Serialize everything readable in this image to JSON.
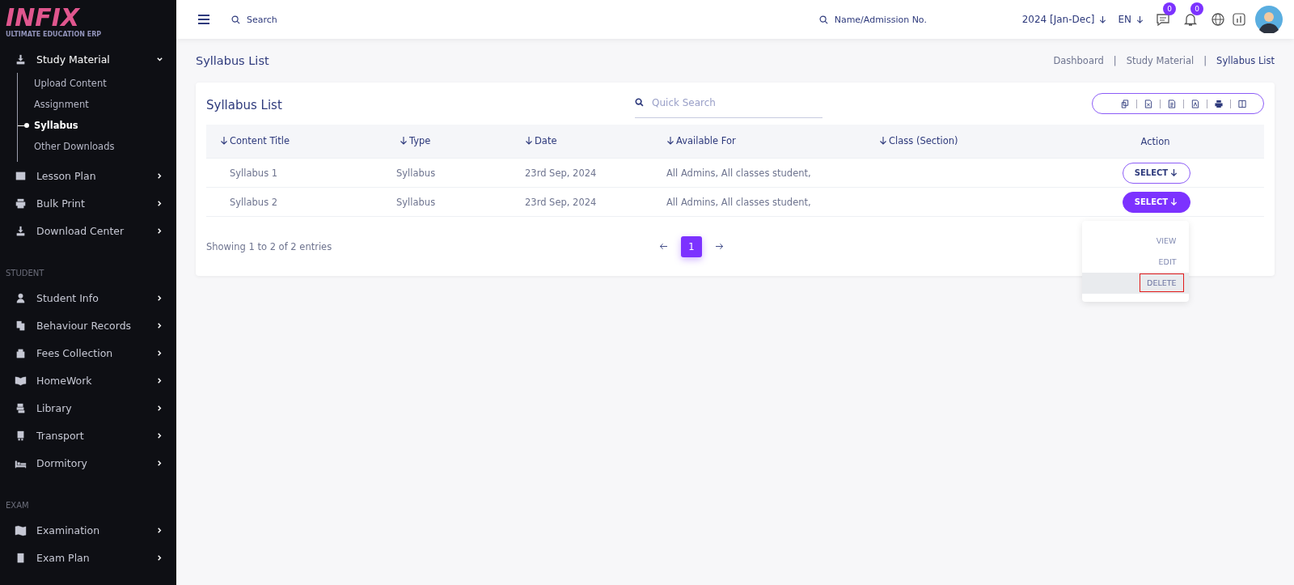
{
  "sidebar": {
    "logo": "INFIX",
    "tagline": "ULTIMATE EDUCATION ERP",
    "sections": [
      {
        "items": [
          {
            "label": "Study Material",
            "expanded": true,
            "children": [
              {
                "label": "Upload Content",
                "selected": false
              },
              {
                "label": "Assignment",
                "selected": false
              },
              {
                "label": "Syllabus",
                "selected": true
              },
              {
                "label": "Other Downloads",
                "selected": false
              }
            ]
          },
          {
            "label": "Lesson Plan",
            "expanded": false
          },
          {
            "label": "Bulk Print",
            "expanded": false
          },
          {
            "label": "Download Center",
            "expanded": false
          }
        ]
      },
      {
        "heading": "STUDENT",
        "items": [
          {
            "label": "Student Info",
            "expanded": false
          },
          {
            "label": "Behaviour Records",
            "expanded": false
          },
          {
            "label": "Fees Collection",
            "expanded": false
          },
          {
            "label": "HomeWork",
            "expanded": false
          },
          {
            "label": "Library",
            "expanded": false
          },
          {
            "label": "Transport",
            "expanded": false
          },
          {
            "label": "Dormitory",
            "expanded": false
          }
        ]
      },
      {
        "heading": "EXAM",
        "items": [
          {
            "label": "Examination",
            "expanded": false
          },
          {
            "label": "Exam Plan",
            "expanded": false
          }
        ]
      }
    ]
  },
  "header": {
    "search": {
      "placeholder": "Search"
    },
    "student_search": {
      "placeholder": "Name/Admission No."
    },
    "session": "2024 [Jan-Dec]",
    "language": "EN",
    "messages_count": "0",
    "notifications_count": "0"
  },
  "page": {
    "title": "Syllabus List",
    "breadcrumb_separator": "|",
    "breadcrumb": [
      {
        "label": "Dashboard",
        "selected": false
      },
      {
        "label": "Study Material",
        "selected": false
      },
      {
        "label": "Syllabus List",
        "selected": true
      }
    ]
  },
  "card": {
    "title": "Syllabus List",
    "quick_search": {
      "placeholder": "Quick Search"
    },
    "table": {
      "columns": [
        {
          "label": "Content Title",
          "sortable": true
        },
        {
          "label": "Type",
          "sortable": true
        },
        {
          "label": "Date",
          "sortable": true
        },
        {
          "label": "Available For",
          "sortable": true
        },
        {
          "label": "Class (Section)",
          "sortable": true
        },
        {
          "label": "Action",
          "sortable": false
        }
      ],
      "rows": [
        {
          "cells": [
            "Syllabus 1",
            "Syllabus",
            "23rd Sep, 2024",
            "All Admins, All classes student,",
            ""
          ],
          "action": "SELECT",
          "menu_open": false
        },
        {
          "cells": [
            "Syllabus 2",
            "Syllabus",
            "23rd Sep, 2024",
            "All Admins, All classes student,",
            ""
          ],
          "action": "SELECT",
          "menu_open": true
        }
      ]
    },
    "menu": [
      {
        "label": "VIEW",
        "selected": false
      },
      {
        "label": "EDIT",
        "selected": false
      },
      {
        "label": "DELETE",
        "selected": true
      }
    ],
    "footer": "Showing 1 to 2 of 2 entries",
    "pagination": [
      {
        "label": "1",
        "selected": true
      }
    ]
  }
}
